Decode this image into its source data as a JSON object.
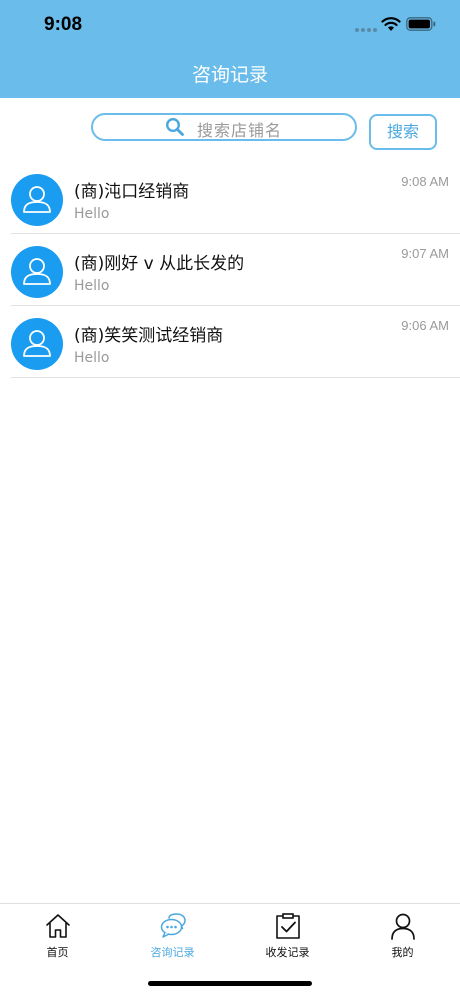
{
  "status_bar": {
    "time": "9:08"
  },
  "header": {
    "title": "咨询记录"
  },
  "search": {
    "placeholder": "搜索店铺名",
    "button_label": "搜索"
  },
  "conversations": [
    {
      "name": "(商)沌口经销商",
      "preview": "Hello",
      "time": "9:08 AM"
    },
    {
      "name": "(商)刚好 v 从此长发的",
      "preview": "Hello",
      "time": "9:07 AM"
    },
    {
      "name": "(商)笑笑测试经销商",
      "preview": "Hello",
      "time": "9:06 AM"
    }
  ],
  "tabbar": {
    "active_tab": "consult",
    "tabs": [
      {
        "key": "home",
        "label": "首页",
        "icon": "home-icon"
      },
      {
        "key": "consult",
        "label": "咨询记录",
        "icon": "chat-bubble-icon"
      },
      {
        "key": "shipping",
        "label": "收发记录",
        "icon": "clipboard-check-icon"
      },
      {
        "key": "mine",
        "label": "我的",
        "icon": "person-icon"
      }
    ]
  },
  "colors": {
    "header_bg": "#6abcea",
    "accent": "#4aa8e0",
    "avatar_bg": "#1a9cf0"
  }
}
